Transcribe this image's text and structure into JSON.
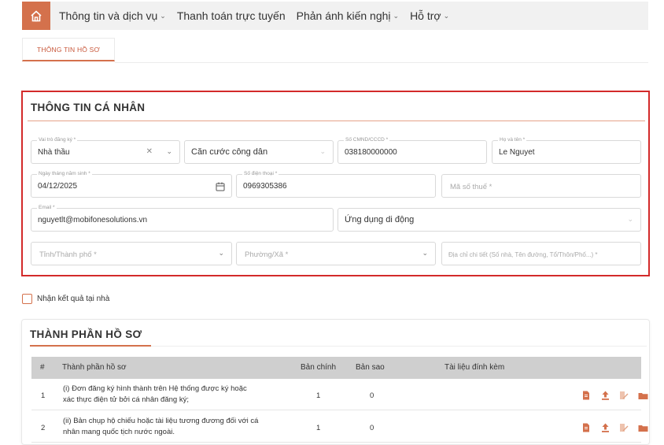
{
  "nav": {
    "items": [
      {
        "label": "Thông tin và dịch vụ",
        "has_dropdown": true
      },
      {
        "label": "Thanh toán trực tuyến",
        "has_dropdown": false
      },
      {
        "label": "Phản ánh kiến nghị",
        "has_dropdown": true
      },
      {
        "label": "Hỗ trợ",
        "has_dropdown": true
      }
    ]
  },
  "tab": {
    "label": "THÔNG TIN HỒ SƠ"
  },
  "personal": {
    "title": "THÔNG TIN CÁ NHÂN",
    "role": {
      "label": "Vai trò đăng ký *",
      "value": "Nhà thầu"
    },
    "id_type": {
      "value": "Căn cước công dân"
    },
    "id_number": {
      "label": "Số CMND/CCCD *",
      "value": "038180000000"
    },
    "full_name": {
      "label": "Họ và tên *",
      "value": "Le Nguyet"
    },
    "dob": {
      "label": "Ngày tháng năm sinh *",
      "value": "04/12/2025"
    },
    "phone": {
      "label": "Số điện thoại *",
      "value": "0969305386"
    },
    "tax_code": {
      "placeholder": "Mã số thuế *"
    },
    "email": {
      "label": "Email *",
      "value": "nguyetlt@mobifonesolutions.vn"
    },
    "app": {
      "value": "Ứng dụng di động"
    },
    "province": {
      "placeholder": "Tỉnh/Thành phố *"
    },
    "ward": {
      "placeholder": "Phường/Xã *"
    },
    "address": {
      "placeholder": "Địa chỉ chi tiết (Số nhà, Tên đường, Tổ/Thôn/Phố...) *"
    }
  },
  "home_delivery": {
    "label": "Nhận kết quả tại nhà",
    "checked": false
  },
  "documents": {
    "title": "THÀNH PHẦN HỒ SƠ",
    "columns": [
      "#",
      "Thành phần hồ sơ",
      "Bản chính",
      "Bản sao",
      "Tài liệu đính kèm"
    ],
    "rows": [
      {
        "index": "1",
        "name_line1": "(i) Đơn đăng ký hình thành trên Hệ thống được ký hoặc",
        "name_line2": "xác thực điện tử bởi cá nhân đăng ký;",
        "original": "1",
        "copy": "0"
      },
      {
        "index": "2",
        "name_line1": "(ii) Bản chụp hộ chiếu hoặc tài liệu tương đương đối với cá",
        "name_line2": "nhân mang quốc tịch nước ngoài.",
        "original": "1",
        "copy": "0"
      }
    ],
    "row_actions": [
      "file-icon",
      "upload-icon",
      "edit-icon",
      "folder-icon"
    ]
  },
  "colors": {
    "accent": "#d4714c",
    "highlight_border": "#d32a2a",
    "table_header": "#cfcfcf"
  }
}
